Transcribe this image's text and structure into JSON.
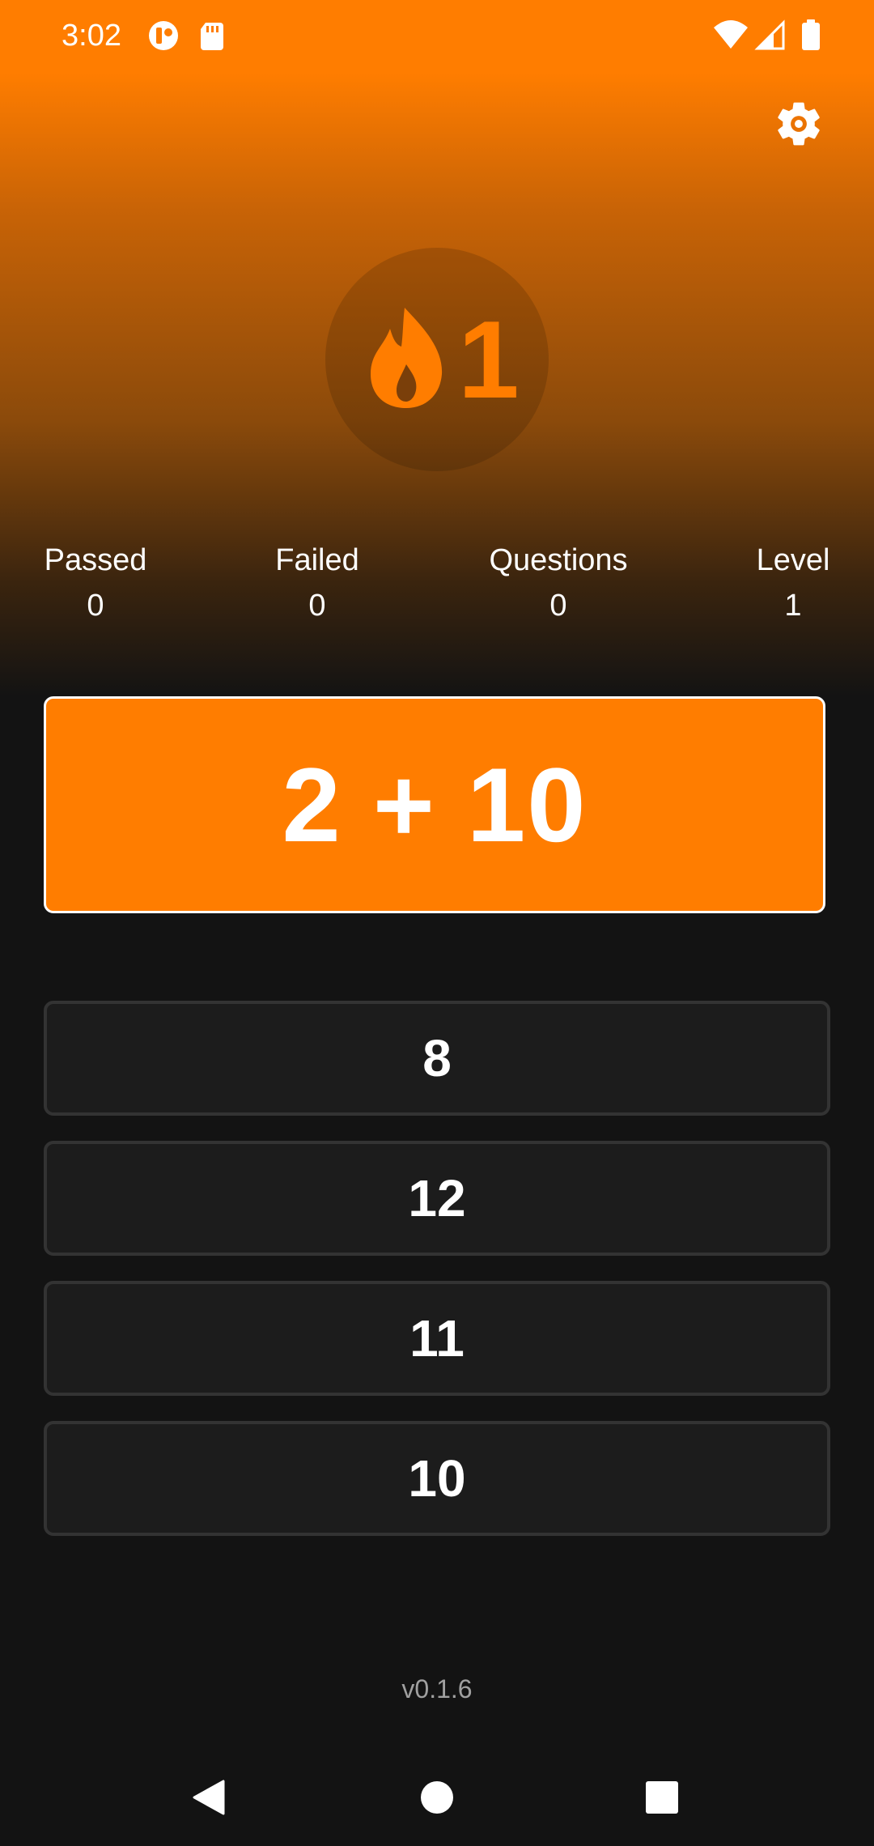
{
  "status_bar": {
    "time": "3:02",
    "left_icons": [
      "app-indicator-icon",
      "sd-card-icon"
    ],
    "right_icons": [
      "wifi-icon",
      "cell-signal-icon",
      "battery-icon"
    ]
  },
  "header": {
    "settings_icon": "gear-icon"
  },
  "streak": {
    "icon": "flame-icon",
    "count": "1"
  },
  "stats": [
    {
      "label": "Passed",
      "value": "0"
    },
    {
      "label": "Failed",
      "value": "0"
    },
    {
      "label": "Questions",
      "value": "0"
    },
    {
      "label": "Level",
      "value": "1"
    }
  ],
  "question": {
    "text": "2 + 10"
  },
  "answers": [
    "8",
    "12",
    "11",
    "10"
  ],
  "footer": {
    "version": "v0.1.6"
  },
  "nav_bar": {
    "icons": [
      "back-icon",
      "home-icon",
      "recents-icon"
    ]
  },
  "colors": {
    "accent": "#ff7d00",
    "background": "#131313",
    "answer_bg": "#1c1c1c",
    "answer_border": "#333333"
  }
}
